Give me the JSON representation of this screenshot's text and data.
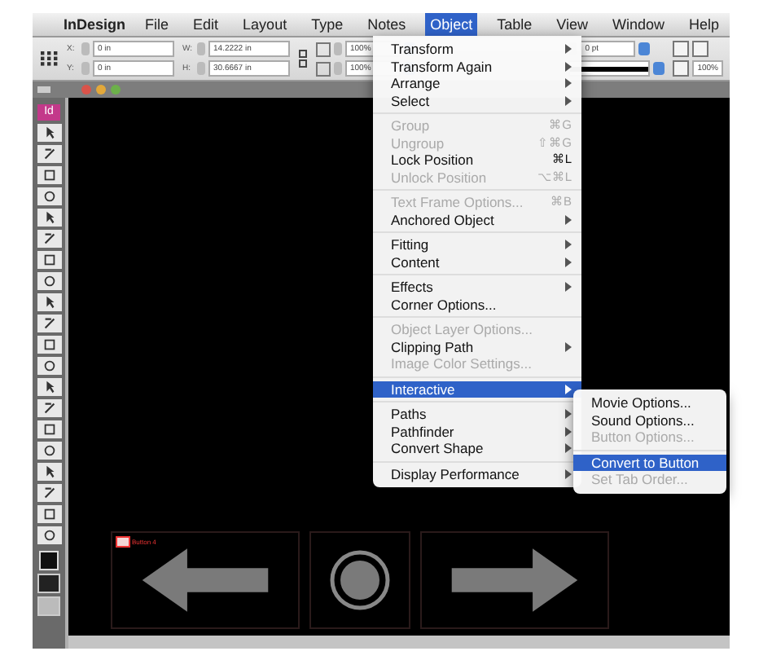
{
  "menubar": {
    "app": "InDesign",
    "menus": [
      {
        "label": "File",
        "selected": false
      },
      {
        "label": "Edit",
        "selected": false
      },
      {
        "label": "Layout",
        "selected": false
      },
      {
        "label": "Type",
        "selected": false
      },
      {
        "label": "Notes",
        "selected": false
      },
      {
        "label": "Object",
        "selected": true
      },
      {
        "label": "Table",
        "selected": false
      },
      {
        "label": "View",
        "selected": false
      },
      {
        "label": "Window",
        "selected": false
      },
      {
        "label": "Help",
        "selected": false
      }
    ]
  },
  "control_panel": {
    "position_fields": [
      {
        "label": "X:",
        "value": "0 in"
      },
      {
        "label": "Y:",
        "value": "0 in"
      }
    ],
    "size_fields": [
      {
        "label": "W:",
        "value": "14.2222 in"
      },
      {
        "label": "H:",
        "value": "30.6667 in"
      }
    ],
    "scale_fields": [
      "100%",
      "100%"
    ],
    "stroke_weight": "0 pt",
    "opacity": "100%"
  },
  "tools_panel": {
    "logo": "Id"
  },
  "object_menu": {
    "items": [
      {
        "kind": "item",
        "label": "Transform",
        "submenu": true,
        "disabled": false,
        "selected": false
      },
      {
        "kind": "item",
        "label": "Transform Again",
        "submenu": true,
        "disabled": false,
        "selected": false
      },
      {
        "kind": "item",
        "label": "Arrange",
        "submenu": true,
        "disabled": false,
        "selected": false
      },
      {
        "kind": "item",
        "label": "Select",
        "submenu": true,
        "disabled": false,
        "selected": false
      },
      {
        "kind": "separator"
      },
      {
        "kind": "item",
        "label": "Group",
        "shortcut": "⌘G",
        "disabled": true,
        "selected": false
      },
      {
        "kind": "item",
        "label": "Ungroup",
        "shortcut": "⇧⌘G",
        "disabled": true,
        "selected": false
      },
      {
        "kind": "item",
        "label": "Lock Position",
        "shortcut": "⌘L",
        "disabled": false,
        "selected": false
      },
      {
        "kind": "item",
        "label": "Unlock Position",
        "shortcut": "⌥⌘L",
        "disabled": true,
        "selected": false
      },
      {
        "kind": "separator"
      },
      {
        "kind": "item",
        "label": "Text Frame Options...",
        "shortcut": "⌘B",
        "disabled": true,
        "selected": false
      },
      {
        "kind": "item",
        "label": "Anchored Object",
        "submenu": true,
        "disabled": false,
        "selected": false
      },
      {
        "kind": "separator"
      },
      {
        "kind": "item",
        "label": "Fitting",
        "submenu": true,
        "disabled": false,
        "selected": false
      },
      {
        "kind": "item",
        "label": "Content",
        "submenu": true,
        "disabled": false,
        "selected": false
      },
      {
        "kind": "separator"
      },
      {
        "kind": "item",
        "label": "Effects",
        "submenu": true,
        "disabled": false,
        "selected": false
      },
      {
        "kind": "item",
        "label": "Corner Options...",
        "disabled": false,
        "selected": false
      },
      {
        "kind": "separator"
      },
      {
        "kind": "item",
        "label": "Object Layer Options...",
        "disabled": true,
        "selected": false
      },
      {
        "kind": "item",
        "label": "Clipping Path",
        "submenu": true,
        "disabled": false,
        "selected": false
      },
      {
        "kind": "item",
        "label": "Image Color Settings...",
        "disabled": true,
        "selected": false
      },
      {
        "kind": "separator"
      },
      {
        "kind": "item",
        "label": "Interactive",
        "submenu": true,
        "disabled": false,
        "selected": true
      },
      {
        "kind": "separator"
      },
      {
        "kind": "item",
        "label": "Paths",
        "submenu": true,
        "disabled": false,
        "selected": false
      },
      {
        "kind": "item",
        "label": "Pathfinder",
        "submenu": true,
        "disabled": false,
        "selected": false
      },
      {
        "kind": "item",
        "label": "Convert Shape",
        "submenu": true,
        "disabled": false,
        "selected": false
      },
      {
        "kind": "separator"
      },
      {
        "kind": "item",
        "label": "Display Performance",
        "submenu": true,
        "disabled": false,
        "selected": false
      }
    ]
  },
  "interactive_submenu": {
    "items": [
      {
        "kind": "item",
        "label": "Movie Options...",
        "disabled": false,
        "selected": false
      },
      {
        "kind": "item",
        "label": "Sound Options...",
        "disabled": false,
        "selected": false
      },
      {
        "kind": "item",
        "label": "Button Options...",
        "disabled": true,
        "selected": false
      },
      {
        "kind": "separator"
      },
      {
        "kind": "item",
        "label": "Convert to Button",
        "disabled": false,
        "selected": true
      },
      {
        "kind": "item",
        "label": "Set Tab Order...",
        "disabled": true,
        "selected": false
      }
    ]
  },
  "canvas": {
    "frame_label": "Button 4"
  }
}
